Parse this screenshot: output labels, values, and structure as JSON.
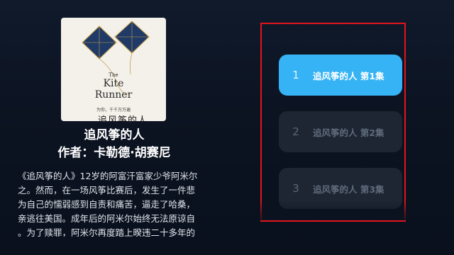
{
  "book": {
    "title": "追风筝的人",
    "author": "作者：卡勒德·胡赛尼",
    "description_lines": [
      "《追风筝的人》12岁的阿富汗富家少爷阿米尔",
      "之。然而，在一场风筝比赛后，发生了一件悲",
      "为自己的懦弱感到自责和痛苦，逼走了哈桑，",
      "亲逃往美国。成年后的阿米尔始终无法原谅自",
      "。为了赎罪，阿米尔再度踏上暌违二十多年的"
    ],
    "cover": {
      "en_small": "The",
      "en_word1": "Kite",
      "en_word2": "Runner",
      "cn_title": "追风筝的人",
      "sub": "为你，千千万万遍"
    }
  },
  "episodes": [
    {
      "num": "1",
      "label": "追风筝的人 第1集",
      "active": true
    },
    {
      "num": "2",
      "label": "追风筝的人 第2集",
      "active": false
    },
    {
      "num": "3",
      "label": "追风筝的人 第3集",
      "active": false
    }
  ],
  "colors": {
    "accent": "#36b3f5",
    "highlight_border": "#e3141c",
    "inactive_item": "#1e2634"
  }
}
